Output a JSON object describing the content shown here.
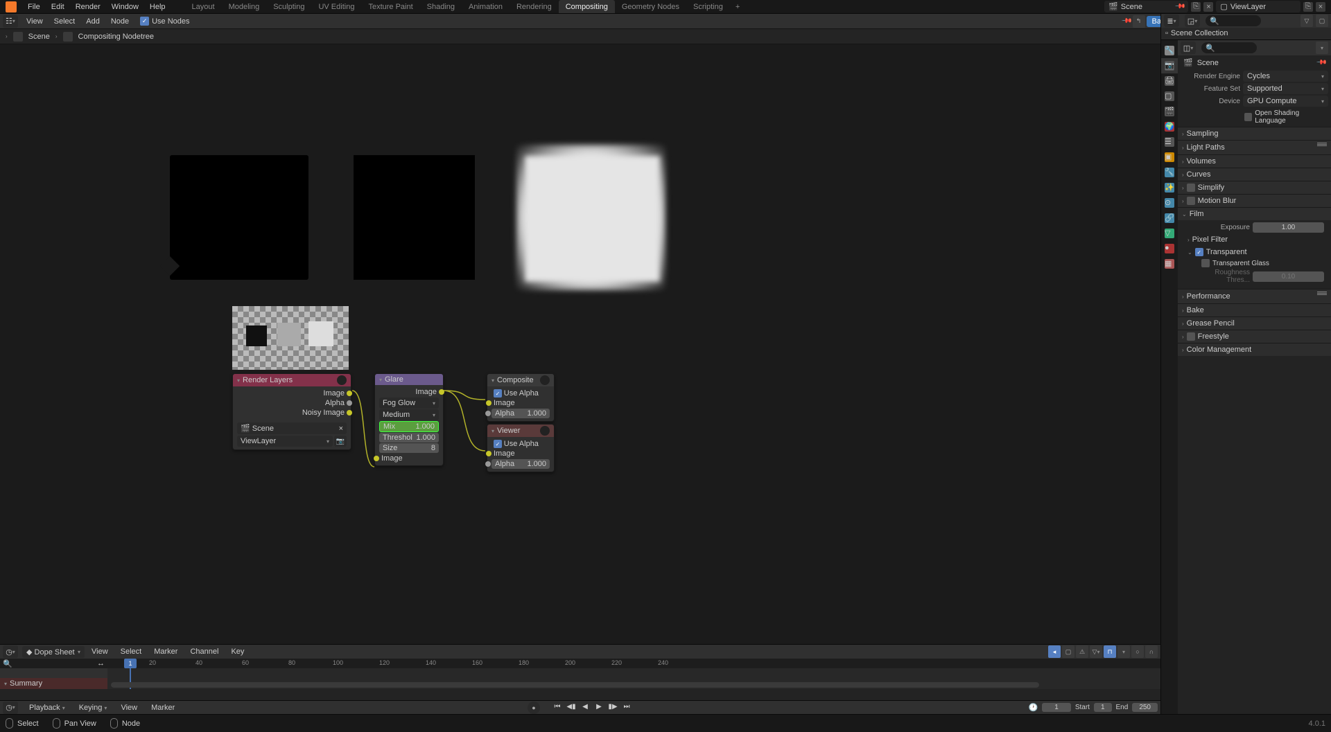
{
  "top_menu": {
    "file": "File",
    "edit": "Edit",
    "render": "Render",
    "window": "Window",
    "help": "Help"
  },
  "workspaces": {
    "layout": "Layout",
    "modeling": "Modeling",
    "sculpting": "Sculpting",
    "uv": "UV Editing",
    "texture": "Texture Paint",
    "shading": "Shading",
    "animation": "Animation",
    "rendering": "Rendering",
    "compositing": "Compositing",
    "geometry": "Geometry Nodes",
    "scripting": "Scripting"
  },
  "scene_name": "Scene",
  "viewlayer_name": "ViewLayer",
  "node_bar": {
    "view": "View",
    "select": "Select",
    "add": "Add",
    "node": "Node",
    "use_nodes": "Use Nodes",
    "backdrop": "Backdrop"
  },
  "breadcrumb": {
    "scene": "Scene",
    "tree": "Compositing Nodetree"
  },
  "nodes": {
    "render_layers": {
      "title": "Render Layers",
      "out_image": "Image",
      "out_alpha": "Alpha",
      "out_noisy": "Noisy Image",
      "scene": "Scene",
      "viewlayer": "ViewLayer"
    },
    "glare": {
      "title": "Glare",
      "out_image": "Image",
      "type": "Fog Glow",
      "quality": "Medium",
      "mix_label": "Mix",
      "mix_val": "1.000",
      "threshold_label": "Threshol",
      "threshold_val": "1.000",
      "size_label": "Size",
      "size_val": "8",
      "in_image": "Image"
    },
    "composite": {
      "title": "Composite",
      "use_alpha": "Use Alpha",
      "in_image": "Image",
      "alpha_label": "Alpha",
      "alpha_val": "1.000"
    },
    "viewer": {
      "title": "Viewer",
      "use_alpha": "Use Alpha",
      "in_image": "Image",
      "alpha_label": "Alpha",
      "alpha_val": "1.000"
    }
  },
  "outliner": {
    "collection": "Scene Collection"
  },
  "props": {
    "scene": "Scene",
    "render_engine_label": "Render Engine",
    "render_engine": "Cycles",
    "feature_set_label": "Feature Set",
    "feature_set": "Supported",
    "device_label": "Device",
    "device": "GPU Compute",
    "osl": "Open Shading Language",
    "panels": {
      "sampling": "Sampling",
      "light_paths": "Light Paths",
      "volumes": "Volumes",
      "curves": "Curves",
      "simplify": "Simplify",
      "motion_blur": "Motion Blur",
      "film": "Film",
      "performance": "Performance",
      "bake": "Bake",
      "grease": "Grease Pencil",
      "freestyle": "Freestyle",
      "color_mgmt": "Color Management"
    },
    "film": {
      "exposure_label": "Exposure",
      "exposure": "1.00",
      "pixel_filter": "Pixel Filter",
      "transparent": "Transparent",
      "transparent_glass": "Transparent Glass",
      "roughness_label": "Roughness Thres...",
      "roughness": "0.10"
    }
  },
  "dope": {
    "mode": "Dope Sheet",
    "view": "View",
    "select": "Select",
    "marker": "Marker",
    "channel": "Channel",
    "key": "Key",
    "summary": "Summary",
    "frames": [
      "20",
      "40",
      "60",
      "80",
      "100",
      "120",
      "140",
      "160",
      "180",
      "200",
      "220",
      "240"
    ]
  },
  "timeline": {
    "playback": "Playback",
    "keying": "Keying",
    "view": "View",
    "marker": "Marker",
    "current": "1",
    "start_label": "Start",
    "start": "1",
    "end_label": "End",
    "end": "250"
  },
  "status": {
    "select": "Select",
    "pan": "Pan View",
    "node": "Node",
    "version": "4.0.1"
  }
}
